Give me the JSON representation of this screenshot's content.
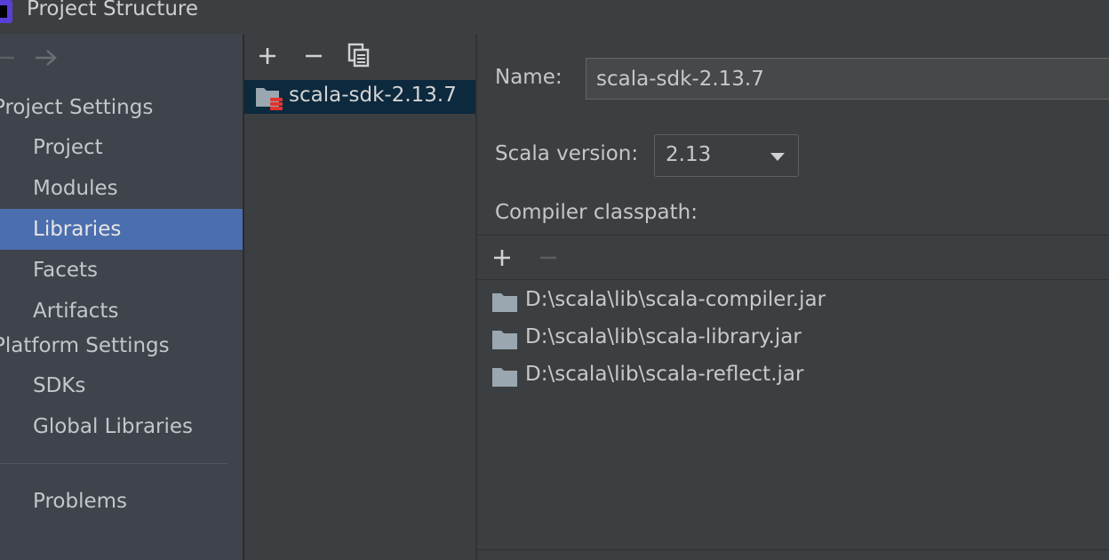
{
  "window": {
    "title": "Project Structure"
  },
  "sidebar": {
    "project_settings_header": "Project Settings",
    "project_items": [
      {
        "label": "Project"
      },
      {
        "label": "Modules"
      },
      {
        "label": "Libraries",
        "selected": true
      },
      {
        "label": "Facets"
      },
      {
        "label": "Artifacts"
      }
    ],
    "platform_settings_header": "Platform Settings",
    "platform_items": [
      {
        "label": "SDKs"
      },
      {
        "label": "Global Libraries"
      }
    ],
    "problems_label": "Problems"
  },
  "libraries": {
    "items": [
      {
        "label": "scala-sdk-2.13.7",
        "selected": true
      }
    ]
  },
  "detail": {
    "name_label": "Name:",
    "name_value": "scala-sdk-2.13.7",
    "scala_version_label": "Scala version:",
    "scala_version_value": "2.13",
    "classpath_label": "Compiler classpath:",
    "classpath": [
      {
        "path": "D:\\scala\\lib\\scala-compiler.jar"
      },
      {
        "path": "D:\\scala\\lib\\scala-library.jar"
      },
      {
        "path": "D:\\scala\\lib\\scala-reflect.jar"
      }
    ]
  },
  "colors": {
    "selection_blue": "#4b6eaf",
    "list_selection": "#0d293e",
    "background": "#3c3f41",
    "sidebar_bg": "#3e434c"
  }
}
